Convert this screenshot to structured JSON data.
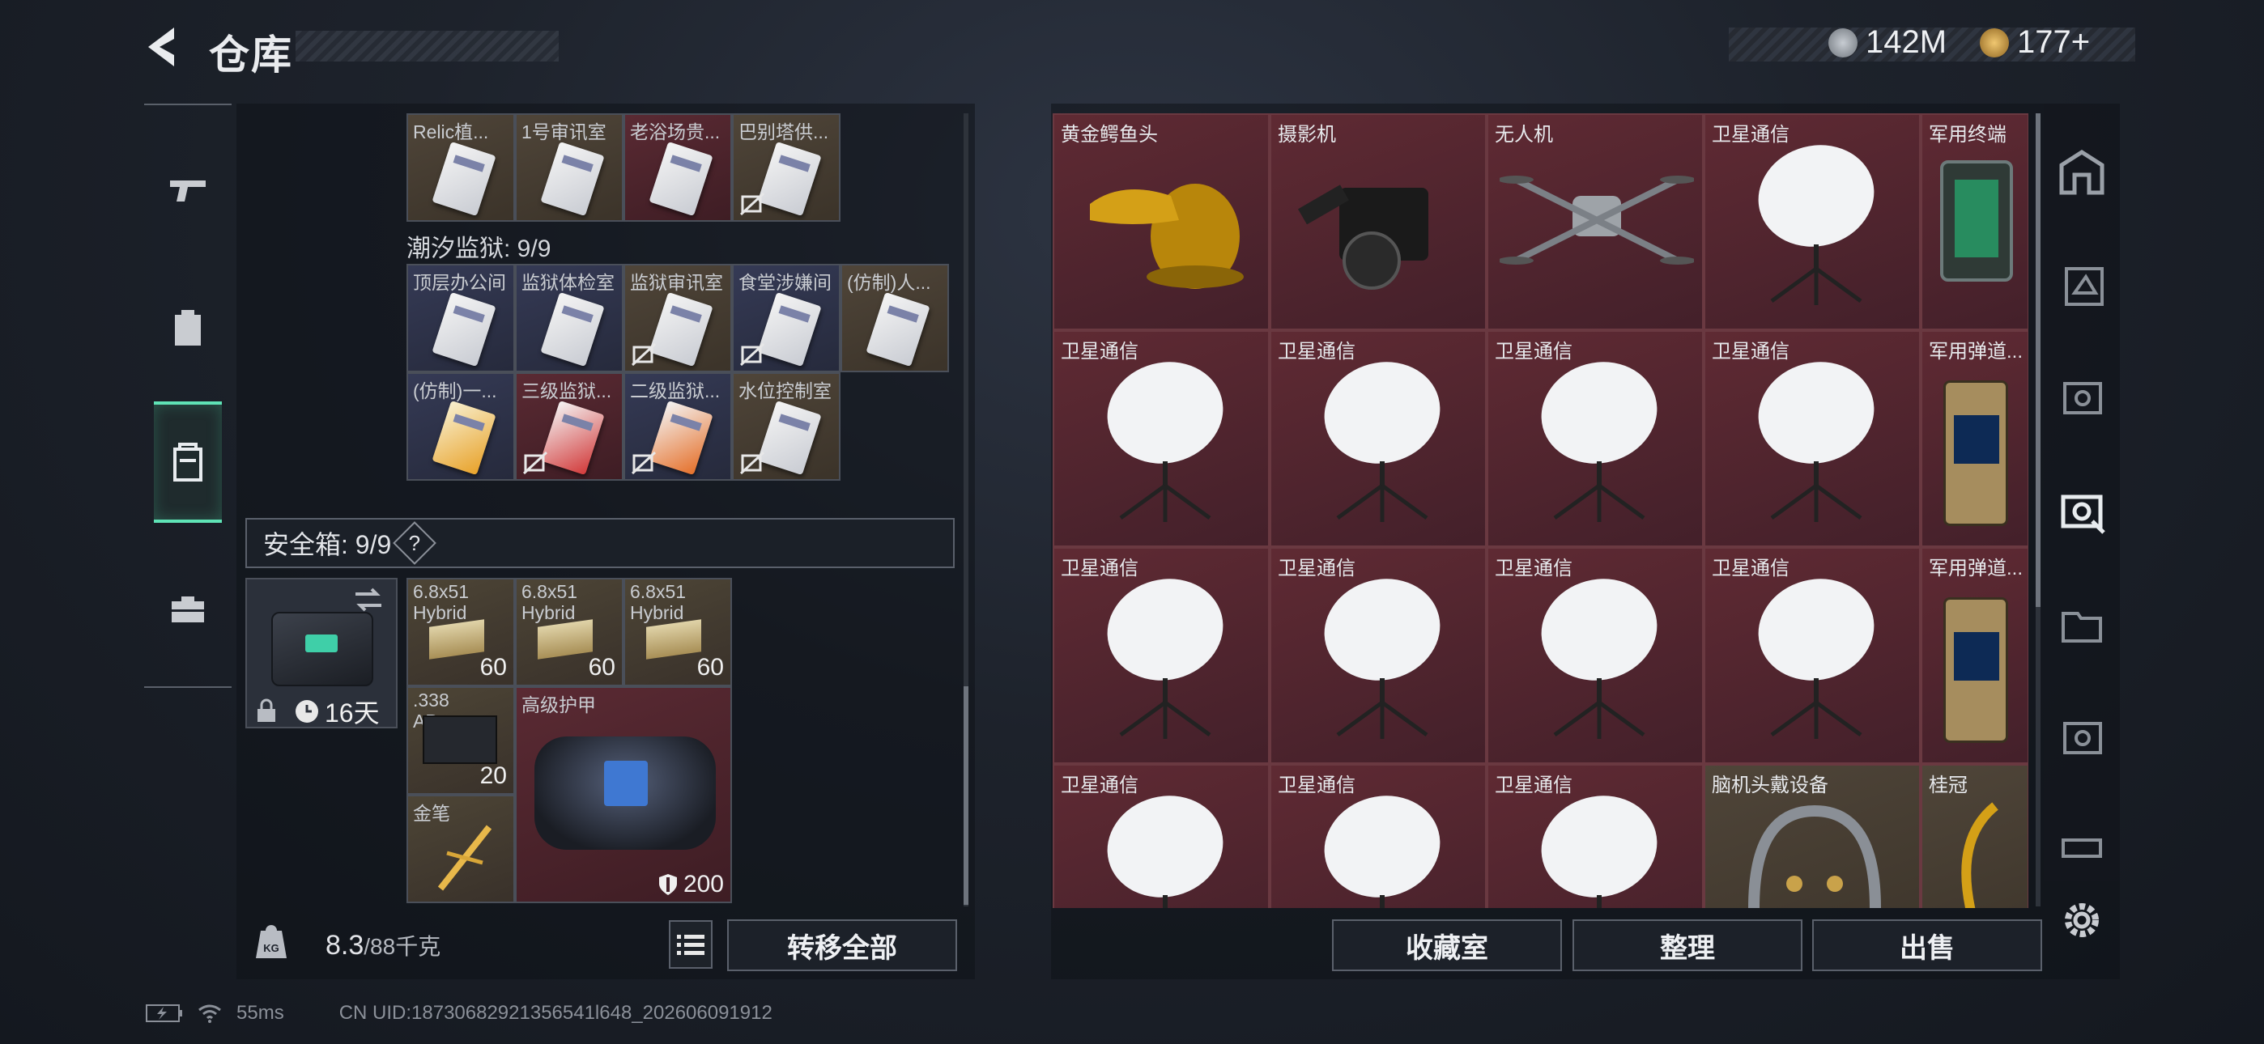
{
  "header": {
    "title": "仓库"
  },
  "currency": [
    {
      "amount": "142M",
      "icon": "silver-coin-icon",
      "color": "#9aa3ad"
    },
    {
      "amount": "177+",
      "icon": "gold-coin-icon",
      "color": "#c99a3c"
    }
  ],
  "left_nav": [
    "weapon-tab",
    "backpack-tab",
    "container-tab",
    "briefcase-tab"
  ],
  "keycards_top_row": [
    "Relic植...",
    "1号审讯室",
    "老浴场贵...",
    "巴别塔供..."
  ],
  "tide_prison": {
    "title": "潮汐监狱: 9/9",
    "row1": [
      "顶层办公间",
      "监狱体检室",
      "监狱审讯室",
      "食堂涉嫌间",
      "(仿制)人..."
    ],
    "row2": [
      "(仿制)一...",
      "三级监狱...",
      "二级监狱...",
      "水位控制室"
    ]
  },
  "safebox": {
    "title": "安全箱: 9/9",
    "help": "?",
    "duration": "16天"
  },
  "secure_items": {
    "ammo": [
      {
        "label": "6.8x51 Hybrid",
        "count": "60"
      },
      {
        "label": "6.8x51 Hybrid",
        "count": "60"
      },
      {
        "label": "6.8x51 Hybrid",
        "count": "60"
      }
    ],
    "ammo338": {
      "label": ".338 AP",
      "count": "20"
    },
    "armor": {
      "label": "高级护甲",
      "durability": "200"
    },
    "pen": {
      "label": "金笔"
    }
  },
  "weight": {
    "current": "8.3",
    "max": "/88千克"
  },
  "left_footer": {
    "transfer_all": "转移全部"
  },
  "right_grid": [
    [
      "黄金鳄鱼头",
      "摄影机",
      "无人机",
      "卫星通信",
      "军用终端"
    ],
    [
      "卫星通信",
      "卫星通信",
      "卫星通信",
      "卫星通信",
      "军用弹道..."
    ],
    [
      "卫星通信",
      "卫星通信",
      "卫星通信",
      "卫星通信",
      "军用弹道..."
    ],
    [
      "卫星通信",
      "卫星通信",
      "卫星通信",
      "脑机头戴设备",
      "桂冠"
    ]
  ],
  "right_footer": {
    "collection": "收藏室",
    "sort": "整理",
    "sell": "出售"
  },
  "status_bar": {
    "ping": "55ms",
    "uid": "CN UID:18730682921356541l648_202606091912"
  }
}
